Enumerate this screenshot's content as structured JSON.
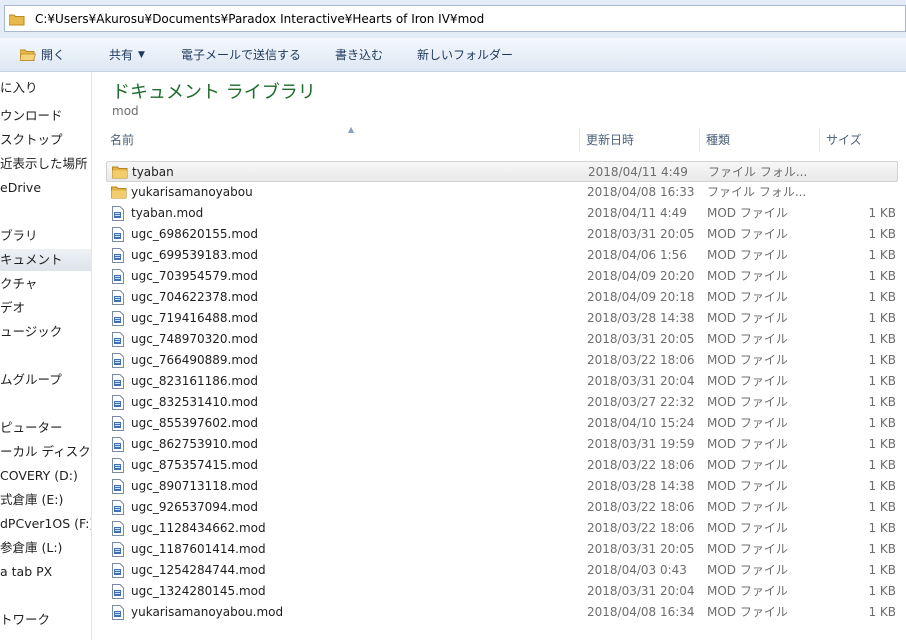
{
  "address": {
    "path": "C:¥Users¥Akurosu¥Documents¥Paradox Interactive¥Hearts of Iron IV¥mod"
  },
  "toolbar": {
    "open": "開く",
    "share": "共有",
    "email": "電子メールで送信する",
    "burn": "書き込む",
    "new_folder": "新しいフォルダー"
  },
  "sidebar": {
    "items": [
      "に入り",
      "ウンロード",
      "スクトップ",
      "近表示した場所",
      "eDrive",
      "ブラリ",
      "キュメント",
      "クチャ",
      "デオ",
      "ュージック",
      "ムグループ",
      "ピューター",
      "ーカル ディスク (",
      "COVERY (D:)",
      "式倉庫 (E:)",
      "dPCver1OS (F:)",
      "参倉庫 (L:)",
      "a tab PX",
      "トワーク"
    ]
  },
  "library": {
    "title": "ドキュメント ライブラリ",
    "subtitle": "mod"
  },
  "columns": {
    "name": "名前",
    "date": "更新日時",
    "type": "種類",
    "size": "サイズ"
  },
  "files": [
    {
      "name": "tyaban",
      "date": "2018/04/11 4:49",
      "type": "ファイル フォル...",
      "size": "",
      "icon": "folder-icon"
    },
    {
      "name": "yukarisamanoyabou",
      "date": "2018/04/08 16:33",
      "type": "ファイル フォル...",
      "size": "",
      "icon": "folder-icon"
    },
    {
      "name": "tyaban.mod",
      "date": "2018/04/11 4:49",
      "type": "MOD ファイル",
      "size": "1 KB",
      "icon": "file-icon"
    },
    {
      "name": "ugc_698620155.mod",
      "date": "2018/03/31 20:05",
      "type": "MOD ファイル",
      "size": "1 KB",
      "icon": "file-icon"
    },
    {
      "name": "ugc_699539183.mod",
      "date": "2018/04/06 1:56",
      "type": "MOD ファイル",
      "size": "1 KB",
      "icon": "file-icon"
    },
    {
      "name": "ugc_703954579.mod",
      "date": "2018/04/09 20:20",
      "type": "MOD ファイル",
      "size": "1 KB",
      "icon": "file-icon"
    },
    {
      "name": "ugc_704622378.mod",
      "date": "2018/04/09 20:18",
      "type": "MOD ファイル",
      "size": "1 KB",
      "icon": "file-icon"
    },
    {
      "name": "ugc_719416488.mod",
      "date": "2018/03/28 14:38",
      "type": "MOD ファイル",
      "size": "1 KB",
      "icon": "file-icon"
    },
    {
      "name": "ugc_748970320.mod",
      "date": "2018/03/31 20:05",
      "type": "MOD ファイル",
      "size": "1 KB",
      "icon": "file-icon"
    },
    {
      "name": "ugc_766490889.mod",
      "date": "2018/03/22 18:06",
      "type": "MOD ファイル",
      "size": "1 KB",
      "icon": "file-icon"
    },
    {
      "name": "ugc_823161186.mod",
      "date": "2018/03/31 20:04",
      "type": "MOD ファイル",
      "size": "1 KB",
      "icon": "file-icon"
    },
    {
      "name": "ugc_832531410.mod",
      "date": "2018/03/27 22:32",
      "type": "MOD ファイル",
      "size": "1 KB",
      "icon": "file-icon"
    },
    {
      "name": "ugc_855397602.mod",
      "date": "2018/04/10 15:24",
      "type": "MOD ファイル",
      "size": "1 KB",
      "icon": "file-icon"
    },
    {
      "name": "ugc_862753910.mod",
      "date": "2018/03/31 19:59",
      "type": "MOD ファイル",
      "size": "1 KB",
      "icon": "file-icon"
    },
    {
      "name": "ugc_875357415.mod",
      "date": "2018/03/22 18:06",
      "type": "MOD ファイル",
      "size": "1 KB",
      "icon": "file-icon"
    },
    {
      "name": "ugc_890713118.mod",
      "date": "2018/03/28 14:38",
      "type": "MOD ファイル",
      "size": "1 KB",
      "icon": "file-icon"
    },
    {
      "name": "ugc_926537094.mod",
      "date": "2018/03/22 18:06",
      "type": "MOD ファイル",
      "size": "1 KB",
      "icon": "file-icon"
    },
    {
      "name": "ugc_1128434662.mod",
      "date": "2018/03/22 18:06",
      "type": "MOD ファイル",
      "size": "1 KB",
      "icon": "file-icon"
    },
    {
      "name": "ugc_1187601414.mod",
      "date": "2018/03/31 20:05",
      "type": "MOD ファイル",
      "size": "1 KB",
      "icon": "file-icon"
    },
    {
      "name": "ugc_1254284744.mod",
      "date": "2018/04/03 0:43",
      "type": "MOD ファイル",
      "size": "1 KB",
      "icon": "file-icon"
    },
    {
      "name": "ugc_1324280145.mod",
      "date": "2018/03/31 20:04",
      "type": "MOD ファイル",
      "size": "1 KB",
      "icon": "file-icon"
    },
    {
      "name": "yukarisamanoyabou.mod",
      "date": "2018/04/08 16:34",
      "type": "MOD ファイル",
      "size": "1 KB",
      "icon": "file-icon"
    }
  ]
}
